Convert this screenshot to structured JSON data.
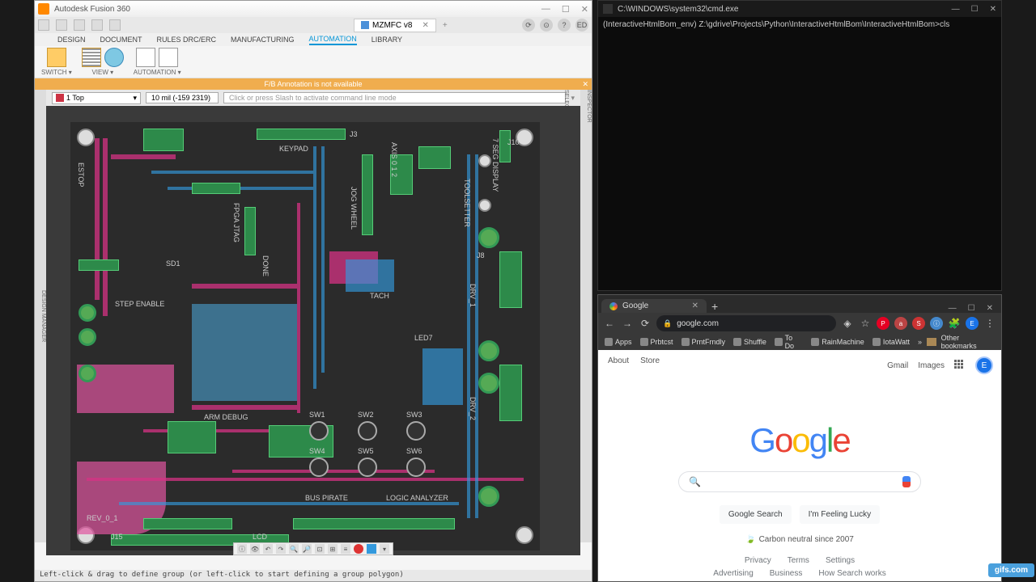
{
  "fusion": {
    "title": "Autodesk Fusion 360",
    "doc_tab": "MZMFC v8",
    "ed_badge": "ED",
    "menu": [
      "DESIGN",
      "DOCUMENT",
      "RULES DRC/ERC",
      "MANUFACTURING",
      "AUTOMATION",
      "LIBRARY"
    ],
    "menu_active": 4,
    "ribbon": {
      "switch": "SWITCH ▾",
      "view": "VIEW ▾",
      "automation": "AUTOMATION ▾"
    },
    "warn": "F/B Annotation is not available",
    "layer": "1 Top",
    "coords": "10 mil (-159 2319)",
    "cmd_placeholder": "Click or press Slash to activate command line mode",
    "sidebar_left": "DESIGN MANAGER",
    "sidebar_right_top": "INSPECTOR",
    "sidebar_right_bot": "SELECTION FILTER",
    "status": "Left-click & drag to define group (or left-click to start defining a group polygon)",
    "silk": {
      "keypad": "KEYPAD",
      "estop": "ESTOP",
      "fpga": "FPGA JTAG",
      "jog": "JOG WHEEL",
      "tool": "TOOLSETTER",
      "7seg": "7 SEG DISPLAY",
      "tach": "TACH",
      "armdbg": "ARM DEBUG",
      "buspirate": "BUS PIRATE",
      "logic": "LOGIC ANALYZER",
      "rev": "REV_0_1",
      "lcd": "LCD",
      "sw1": "SW1",
      "sw2": "SW2",
      "sw3": "SW3",
      "sw4": "SW4",
      "sw5": "SW5",
      "sw6": "SW6",
      "led7": "LED7",
      "drv1": "DRV_1",
      "drv2": "DRV_2",
      "axis2": "AXIS 0 1 2",
      "j10": "J10",
      "j15": "J15",
      "j3": "J3",
      "j8": "J8",
      "sd1": "SD1",
      "done": "DONE",
      "step": "STEP ENABLE"
    }
  },
  "cmd": {
    "title": "C:\\WINDOWS\\system32\\cmd.exe",
    "line": "(InteractiveHtmlBom_env) Z:\\gdrive\\Projects\\Python\\InteractiveHtmlBom\\InteractiveHtmlBom>cls"
  },
  "chrome": {
    "tab_title": "Google",
    "url": "google.com",
    "bookmarks": [
      "Apps",
      "Prbtcst",
      "PrntFrndly",
      "Shuffle",
      "To Do",
      "RainMachine",
      "IotaWatt"
    ],
    "other_bm": "Other bookmarks",
    "topbar_left": [
      "About",
      "Store"
    ],
    "topbar_right": [
      "Gmail",
      "Images"
    ],
    "avatar": "E",
    "btn_search": "Google Search",
    "btn_lucky": "I'm Feeling Lucky",
    "carbon": "Carbon neutral since 2007",
    "footer1": [
      "Privacy",
      "Terms",
      "Settings"
    ],
    "footer2": [
      "Advertising",
      "Business",
      "How Search works"
    ]
  },
  "gifs_badge": "gifs.com"
}
